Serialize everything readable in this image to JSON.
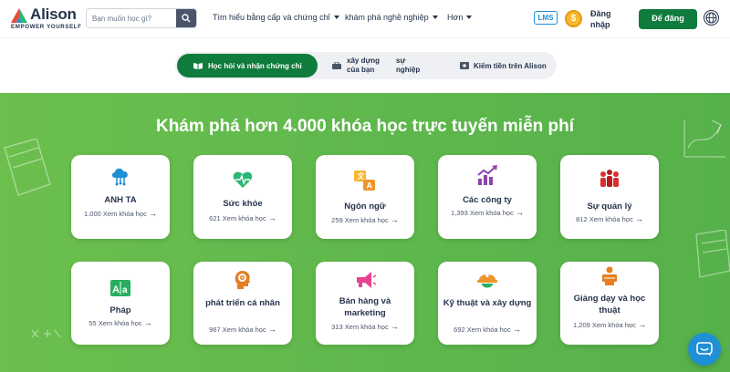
{
  "brand": {
    "name": "Alison",
    "tagline": "EMPOWER YOURSELF"
  },
  "search": {
    "placeholder": "Bạn muốn học gì?"
  },
  "nav": {
    "items": [
      {
        "label": "Tìm hiểu bằng cấp và chứng chỉ"
      },
      {
        "label": "khám phá nghề nghiệp"
      },
      {
        "label": "Hơn"
      }
    ],
    "lms": "LMS",
    "coin": "$",
    "login": "Đăng nhập",
    "signup": "Để đăng"
  },
  "tabs": [
    {
      "label": "Học hỏi và nhận chứng chỉ",
      "active": true
    },
    {
      "label": "xây dựng của bạn",
      "active": false
    },
    {
      "label": "sự nghiệp",
      "active": false
    },
    {
      "label": "Kiếm tiền trên Alison",
      "active": false
    }
  ],
  "hero": {
    "title": "Khám phá hơn 4.000 khóa học trực tuyến miễn phí"
  },
  "categories": [
    {
      "name": "ANH TA",
      "courses": "1.000 Xem khóa học",
      "icon": "cloud-network-icon",
      "color": "#1f8fd6"
    },
    {
      "name": "Sức khỏe",
      "courses": "621 Xem khóa học",
      "icon": "heartbeat-icon",
      "color": "#2bb673"
    },
    {
      "name": "Ngôn ngữ",
      "courses": "259 Xem khóa học",
      "icon": "translate-icon",
      "color": "#f7b731"
    },
    {
      "name": "Các công ty",
      "courses": "1,393 Xem khóa học",
      "icon": "growth-chart-icon",
      "color": "#8e44ad"
    },
    {
      "name": "Sự quản lý",
      "courses": "812 Xem khóa học",
      "icon": "team-icon",
      "color": "#d63031"
    },
    {
      "name": "Pháp",
      "courses": "55 Xem khóa học",
      "icon": "language-aa-icon",
      "color": "#27ae60"
    },
    {
      "name": "phát triển cá nhân",
      "courses": "967 Xem khóa học",
      "icon": "target-head-icon",
      "color": "#e67e22"
    },
    {
      "name": "Bán hàng và marketing",
      "courses": "313 Xem khóa học",
      "icon": "megaphone-icon",
      "color": "#e84393"
    },
    {
      "name": "Kỹ thuật và xây dựng",
      "courses": "692 Xem khóa học",
      "icon": "hard-hat-icon",
      "color": "#f0932b"
    },
    {
      "name": "Giảng dạy và học thuật",
      "courses": "1,209 Xem khóa học",
      "icon": "teacher-board-icon",
      "color": "#e67e22"
    }
  ]
}
